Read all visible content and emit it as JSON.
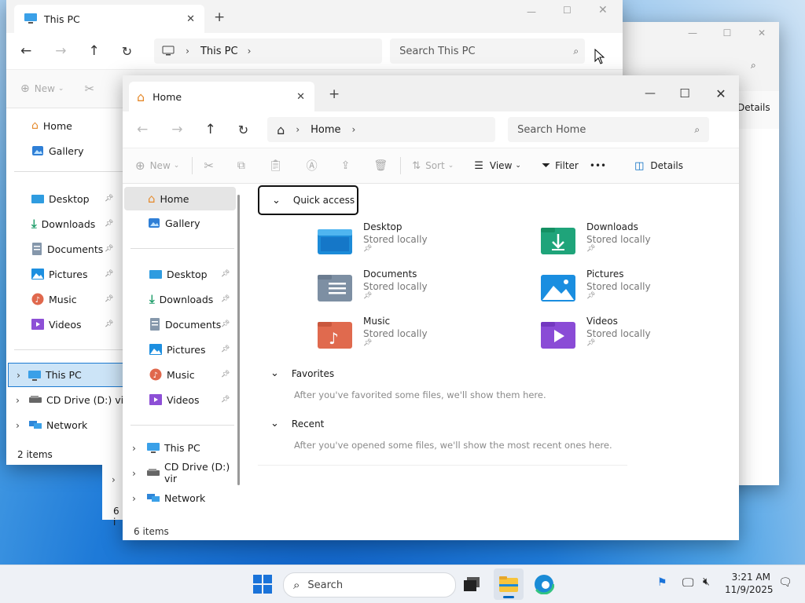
{
  "back2": {
    "tab_label": "Details",
    "search_icon": "search-icon"
  },
  "back1": {
    "tab_title": "This PC",
    "new_tab": "+",
    "address_segment": "This PC",
    "search_placeholder": "Search This PC",
    "new_label": "New",
    "nav": [
      {
        "label": "Home",
        "icon": "home-icon"
      },
      {
        "label": "Gallery",
        "icon": "gallery-icon"
      },
      {
        "label": "Desktop",
        "icon": "desktop-folder-icon",
        "pinned": true
      },
      {
        "label": "Downloads",
        "icon": "downloads-folder-icon",
        "pinned": true
      },
      {
        "label": "Documents",
        "icon": "documents-folder-icon",
        "pinned": true
      },
      {
        "label": "Pictures",
        "icon": "pictures-folder-icon",
        "pinned": true
      },
      {
        "label": "Music",
        "icon": "music-folder-icon",
        "pinned": true
      },
      {
        "label": "Videos",
        "icon": "videos-folder-icon",
        "pinned": true
      },
      {
        "label": "This PC",
        "icon": "this-pc-icon",
        "selected": true
      },
      {
        "label": "CD Drive (D:) vir",
        "icon": "cd-drive-icon"
      },
      {
        "label": "Network",
        "icon": "network-icon"
      }
    ],
    "status": "2 items",
    "status_behind": "6 i"
  },
  "front": {
    "tab_title": "Home",
    "new_tab": "+",
    "address_segment": "Home",
    "search_placeholder": "Search Home",
    "toolbar": {
      "new": "New",
      "sort": "Sort",
      "view": "View",
      "filter": "Filter",
      "more": "•••",
      "details": "Details"
    },
    "nav": [
      {
        "label": "Home",
        "icon": "home-icon",
        "selected": true
      },
      {
        "label": "Gallery",
        "icon": "gallery-icon"
      },
      {
        "label": "Desktop",
        "icon": "desktop-folder-icon",
        "pinned": true
      },
      {
        "label": "Downloads",
        "icon": "downloads-folder-icon",
        "pinned": true
      },
      {
        "label": "Documents",
        "icon": "documents-folder-icon",
        "pinned": true
      },
      {
        "label": "Pictures",
        "icon": "pictures-folder-icon",
        "pinned": true
      },
      {
        "label": "Music",
        "icon": "music-folder-icon",
        "pinned": true
      },
      {
        "label": "Videos",
        "icon": "videos-folder-icon",
        "pinned": true
      },
      {
        "label": "This PC",
        "icon": "this-pc-icon"
      },
      {
        "label": "CD Drive (D:) vir",
        "icon": "cd-drive-icon"
      },
      {
        "label": "Network",
        "icon": "network-icon"
      }
    ],
    "quick_access": {
      "title": "Quick access",
      "items": [
        {
          "name": "Desktop",
          "sub": "Stored locally"
        },
        {
          "name": "Downloads",
          "sub": "Stored locally"
        },
        {
          "name": "Documents",
          "sub": "Stored locally"
        },
        {
          "name": "Pictures",
          "sub": "Stored locally"
        },
        {
          "name": "Music",
          "sub": "Stored locally"
        },
        {
          "name": "Videos",
          "sub": "Stored locally"
        }
      ]
    },
    "favorites": {
      "title": "Favorites",
      "empty": "After you've favorited some files, we'll show them here."
    },
    "recent": {
      "title": "Recent",
      "empty": "After you've opened some files, we'll show the most recent ones here."
    },
    "status": "6 items"
  },
  "taskbar": {
    "search_placeholder": "Search",
    "time": "3:21 AM",
    "date": "11/9/2025"
  },
  "colors": {
    "accent": "#0067c0",
    "selection": "#cce4f7",
    "folder_blue": "#3aa0e8"
  }
}
